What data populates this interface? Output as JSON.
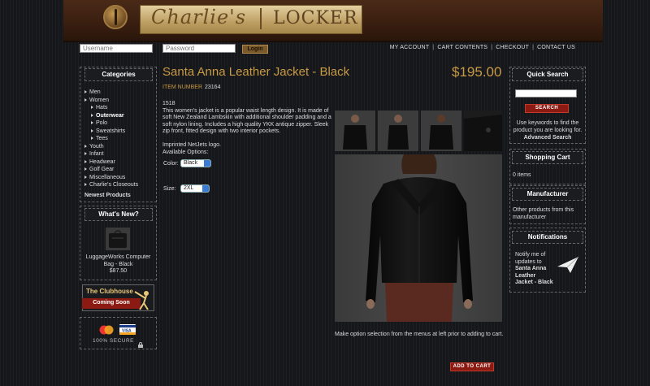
{
  "header": {
    "logo_left": "Charlie's",
    "logo_right": "LOCKER"
  },
  "login": {
    "username_placeholder": "Username",
    "password_placeholder": "Password",
    "login_label": "Login"
  },
  "top_links": [
    "MY ACCOUNT",
    "CART CONTENTS",
    "CHECKOUT",
    "CONTACT US"
  ],
  "categories": {
    "title": "Categories",
    "items": [
      {
        "label": "Men",
        "level": 0
      },
      {
        "label": "Women",
        "level": 0
      },
      {
        "label": "Hats",
        "level": 1
      },
      {
        "label": "Outerwear",
        "level": 1,
        "active": true
      },
      {
        "label": "Polo",
        "level": 1
      },
      {
        "label": "Sweatshirts",
        "level": 1
      },
      {
        "label": "Tees",
        "level": 1
      },
      {
        "label": "Youth",
        "level": 0
      },
      {
        "label": "Infant",
        "level": 0
      },
      {
        "label": "Headwear",
        "level": 0
      },
      {
        "label": "Golf Gear",
        "level": 0
      },
      {
        "label": "Miscellaneous",
        "level": 0
      },
      {
        "label": "Charlie's Closeouts",
        "level": 0
      }
    ],
    "newest": "Newest Products"
  },
  "whats_new": {
    "title": "What's New?",
    "product_name_1": "LuggageWorks Computer",
    "product_name_2": "Bag - Black",
    "price": "$87.50"
  },
  "clubhouse": {
    "title": "The Clubhouse",
    "banner": "Coming Soon"
  },
  "payment": {
    "secure": "100% SECURE",
    "cards": [
      "MasterCard",
      "VISA"
    ]
  },
  "product": {
    "title": "Santa Anna Leather Jacket - Black",
    "price": "$195.00",
    "item_number_label": "ITEM NUMBER",
    "item_number": "23164",
    "code": "1518",
    "description": "This women's jacket is a popular waist length design. It is made of soft New Zealand Lambskin with additional shoulder padding and a soft nylon lining. Includes a high quality YKK antique zipper. Sleek zip front, fitted design with two interior pockets.",
    "logo_note": "Imprinted NetJets logo.",
    "options_label": "Available Options:",
    "color_label": "Color:",
    "color_value": "Black",
    "size_label": "Size:",
    "size_value": "2XL",
    "selection_note": "Make option selection from the menus at left prior to adding to cart.",
    "add_to_cart": "ADD TO CART"
  },
  "quick_search": {
    "title": "Quick Search",
    "button": "SEARCH",
    "help": "Use keywords to find the product you are looking for.",
    "advanced": "Advanced Search"
  },
  "shopping_cart": {
    "title": "Shopping Cart",
    "items": "0 items"
  },
  "manufacturer": {
    "title": "Manufacturer",
    "text": "Other products from this manufacturer"
  },
  "notifications": {
    "title": "Notifications",
    "text_1": "Notify me of",
    "text_2": "updates to",
    "product_1": "Santa Anna",
    "product_2": "Leather",
    "product_3": "Jacket - Black"
  },
  "colors": {
    "gold": "#c99a44",
    "button_red": "#8a1a12",
    "background": "#15171b"
  }
}
